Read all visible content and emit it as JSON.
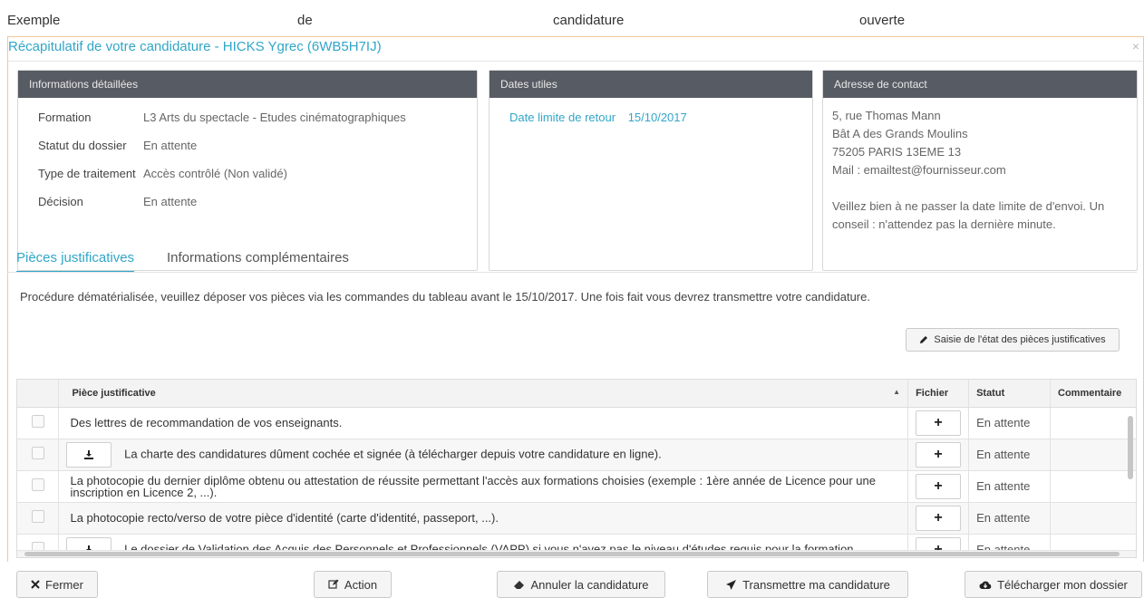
{
  "caption": {
    "words": [
      "Exemple",
      "de",
      "candidature",
      "ouverte"
    ]
  },
  "modal": {
    "title": "Récapitulatif de votre candidature - HICKS Ygrec (6WB5H7IJ)",
    "close_symbol": "×"
  },
  "info_panel": {
    "header": "Informations détaillées",
    "rows": [
      {
        "label": "Formation",
        "value": "L3 Arts du spectacle - Etudes cinématographiques"
      },
      {
        "label": "Statut du dossier",
        "value": "En attente"
      },
      {
        "label": "Type de traitement",
        "value": "Accès contrôlé (Non validé)"
      },
      {
        "label": "Décision",
        "value": "En attente"
      }
    ]
  },
  "dates_panel": {
    "header": "Dates utiles",
    "label": "Date limite de retour",
    "value": "15/10/2017"
  },
  "contact_panel": {
    "header": "Adresse de contact",
    "lines": [
      "5, rue Thomas Mann",
      "Bât A des Grands Moulins",
      "75205 PARIS 13EME 13",
      "Mail : emailtest@fournisseur.com"
    ],
    "note": "Veillez bien à ne passer la date limite de d'envoi. Un conseil : n'attendez pas la dernière minute."
  },
  "tabs": [
    {
      "label": "Pièces justificatives",
      "active": true
    },
    {
      "label": "Informations complémentaires",
      "active": false
    }
  ],
  "procedure_text": "Procédure dématérialisée, veuillez déposer vos pièces via les commandes du tableau avant le 15/10/2017. Une fois fait vous devrez transmettre votre candidature.",
  "saisie_button": {
    "label": "Saisie de l'état des pièces justificatives",
    "icon": "pencil-icon"
  },
  "table": {
    "headers": {
      "piece": "Pièce justificative",
      "fichier": "Fichier",
      "statut": "Statut",
      "commentaire": "Commentaire"
    },
    "sort_symbol": "▲",
    "rows": [
      {
        "piece": "Des lettres de recommandation de vos enseignants.",
        "statut": "En attente",
        "commentaire": "",
        "has_download": false
      },
      {
        "piece": "La charte des candidatures dûment cochée et signée (à télécharger depuis votre candidature en ligne).",
        "statut": "En attente",
        "commentaire": "",
        "has_download": true
      },
      {
        "piece": "La photocopie du dernier diplôme obtenu ou attestation de réussite permettant l'accès aux formations choisies (exemple : 1ère année de Licence pour une inscription en Licence 2, ...).",
        "statut": "En attente",
        "commentaire": "",
        "has_download": false
      },
      {
        "piece": "La photocopie recto/verso de votre pièce d'identité (carte d'identité, passeport, ...).",
        "statut": "En attente",
        "commentaire": "",
        "has_download": false
      },
      {
        "piece": "Le dossier de Validation des Acquis des Personnels et Professionnels (VAPP) si vous n'avez pas le niveau d'études requis pour la formation",
        "statut": "En attente",
        "commentaire": "",
        "has_download": true
      }
    ]
  },
  "footer": {
    "fermer": "Fermer",
    "action": "Action",
    "annuler": "Annuler la candidature",
    "transmettre": "Transmettre ma candidature",
    "telecharger": "Télécharger mon dossier"
  }
}
